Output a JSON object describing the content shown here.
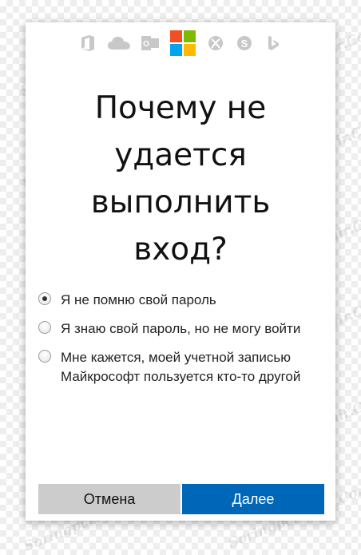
{
  "header": {
    "icons": [
      "office-icon",
      "onedrive-icon",
      "outlook-icon",
      "microsoft-logo",
      "xbox-icon",
      "skype-icon",
      "bing-icon"
    ],
    "icon_color": "#c8c8c8",
    "logo_colors": [
      "#f25022",
      "#7fba00",
      "#00a4ef",
      "#ffb900"
    ]
  },
  "dialog": {
    "title": "Почему не удается выполнить вход?"
  },
  "options": [
    {
      "label": "Я не помню свой пароль",
      "checked": true
    },
    {
      "label": "Я знаю свой пароль, но не могу войти",
      "checked": false
    },
    {
      "label": "Мне кажется, моей учетной записью Майкрософт пользуется кто-то другой",
      "checked": false
    }
  ],
  "buttons": {
    "cancel_label": "Отмена",
    "next_label": "Далее"
  },
  "colors": {
    "accent": "#0067b8",
    "cancel_bg": "#cccccc"
  },
  "watermark": {
    "text": "Soringpcrepair.Com"
  }
}
